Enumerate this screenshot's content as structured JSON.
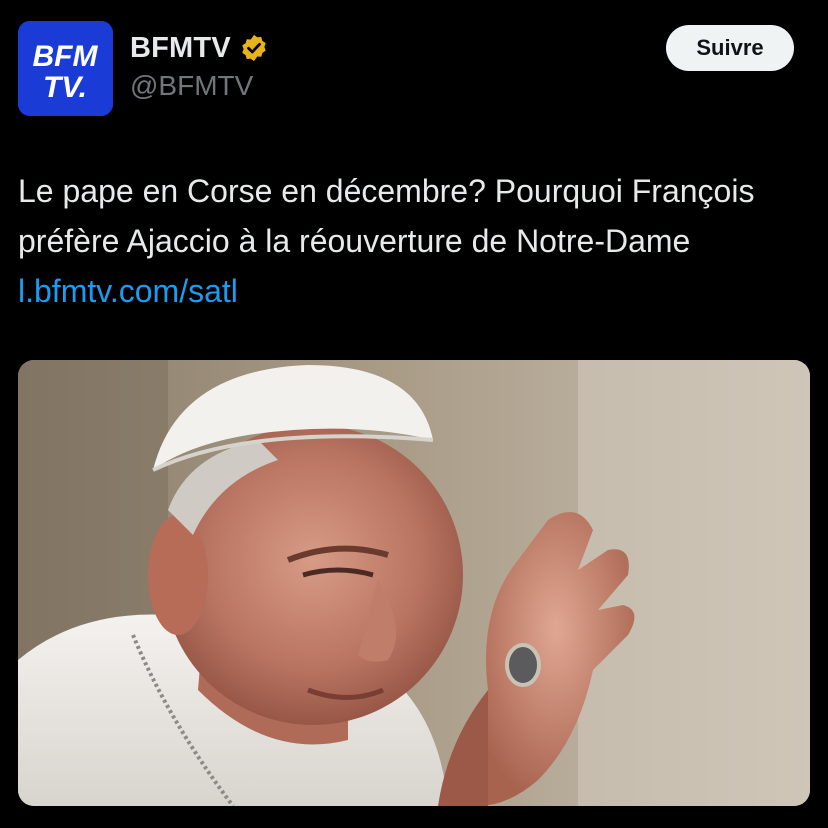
{
  "author": {
    "display_name": "BFMTV",
    "handle": "@BFMTV",
    "avatar_logo_text": "BFM TV.",
    "verified_badge_color": "#e8b31a",
    "avatar_color": "#1a3bd6"
  },
  "follow_button": {
    "label": "Suivre"
  },
  "tweet": {
    "text": "Le pape en Corse en décembre? Pourquoi François préfère Ajaccio à la réouverture de Notre-Dame ",
    "link_text": "l.bfmtv.com/satl",
    "link_color": "#1d9bf0"
  },
  "media": {
    "alt": "photo"
  },
  "icons": {
    "verified": "verified-badge-icon"
  }
}
